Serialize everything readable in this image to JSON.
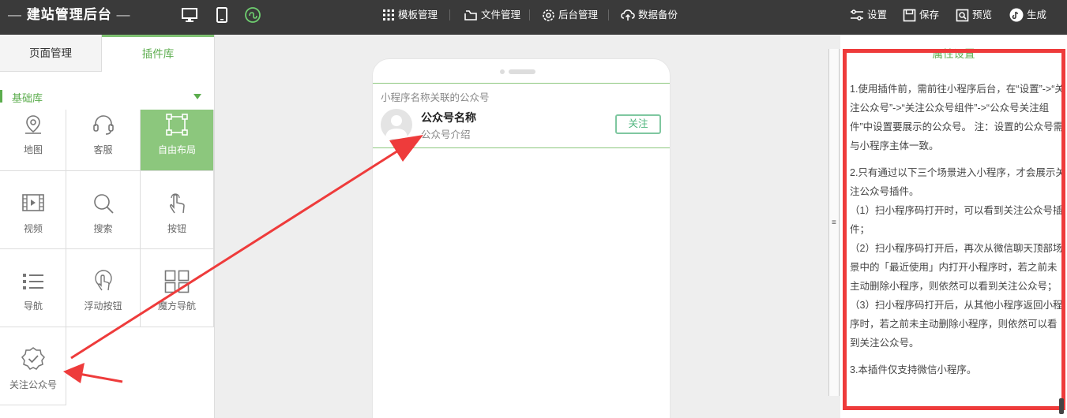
{
  "topbar": {
    "brand": "建站管理后台",
    "brand_dash_left": "—",
    "brand_dash_right": "—",
    "device_icons": [
      "desktop-icon",
      "mobile-icon",
      "miniprogram-icon"
    ],
    "menu": [
      {
        "label": "模板管理",
        "icon": "grid-icon"
      },
      {
        "label": "文件管理",
        "icon": "folder-icon"
      },
      {
        "label": "后台管理",
        "icon": "gear-icon"
      },
      {
        "label": "数据备份",
        "icon": "cloud-upload-icon"
      }
    ],
    "actions": [
      {
        "label": "设置",
        "icon": "sliders-icon"
      },
      {
        "label": "保存",
        "icon": "save-icon"
      },
      {
        "label": "预览",
        "icon": "preview-icon"
      },
      {
        "label": "生成",
        "icon": "tiktok-icon"
      }
    ]
  },
  "left": {
    "tabs": [
      "页面管理",
      "插件库"
    ],
    "active_tab": "插件库",
    "library": "基础库",
    "plugins": [
      {
        "label": "地图",
        "icon": "map-pin-icon"
      },
      {
        "label": "客服",
        "icon": "headset-icon"
      },
      {
        "label": "自由布局",
        "icon": "free-layout-icon",
        "active": true
      },
      {
        "label": "视频",
        "icon": "video-icon"
      },
      {
        "label": "搜索",
        "icon": "search-icon"
      },
      {
        "label": "按钮",
        "icon": "tap-icon"
      },
      {
        "label": "导航",
        "icon": "list-icon"
      },
      {
        "label": "浮动按钮",
        "icon": "float-button-icon"
      },
      {
        "label": "魔方导航",
        "icon": "cube-nav-icon"
      },
      {
        "label": "关注公众号",
        "icon": "verified-badge-icon"
      }
    ]
  },
  "phone": {
    "card": {
      "hint": "小程序名称关联的公众号",
      "name": "公众号名称",
      "intro": "公众号介绍",
      "follow": "关注"
    }
  },
  "right": {
    "title": "属性设置",
    "paragraphs": [
      "1.使用插件前，需前往小程序后台，在“设置”->“关注公众号”->“关注公众号组件”->“公众号关注组件”中设置要展示的公众号。 注：设置的公众号需与小程序主体一致。",
      "2.只有通过以下三个场景进入小程序，才会展示关注公众号插件。",
      "（1）扫小程序码打开时，可以看到关注公众号插件；",
      "（2）扫小程序码打开后，再次从微信聊天顶部场景中的「最近使用」内打开小程序时，若之前未主动删除小程序，则依然可以看到关注公众号；",
      "（3）扫小程序码打开后，从其他小程序返回小程序时，若之前未主动删除小程序，则依然可以看到关注公众号。",
      "3.本插件仅支持微信小程序。"
    ]
  },
  "colors": {
    "accent": "#5cad4e",
    "active_cell": "#8cc77d",
    "annotation_red": "#ee3b3b",
    "topbar": "#3a3a3a"
  }
}
